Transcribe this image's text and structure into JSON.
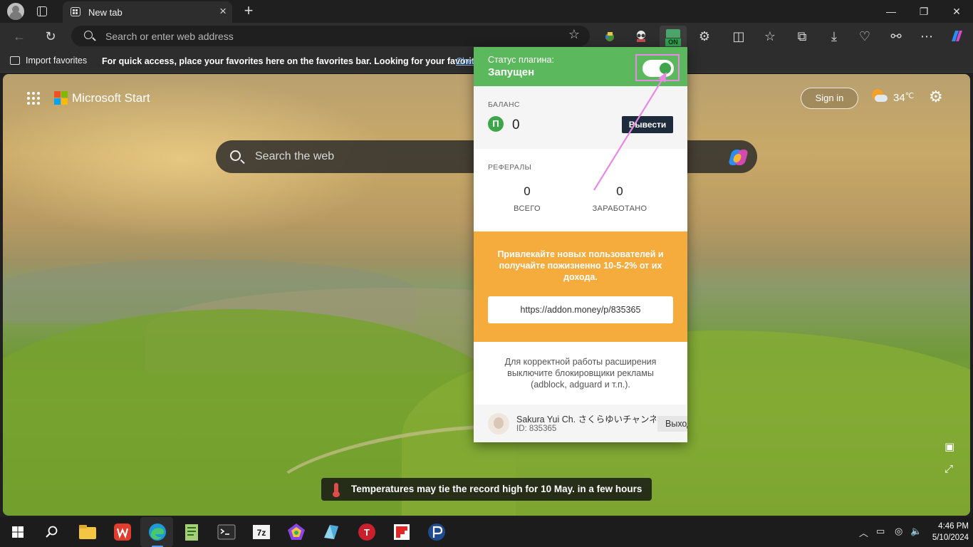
{
  "browser": {
    "tab_title": "New tab",
    "tab_close": "×",
    "new_tab": "+",
    "window_controls": {
      "minimize": "—",
      "maximize": "❐",
      "close": "✕"
    },
    "address_placeholder": "Search or enter web address",
    "favorites_bar": {
      "import_label": "Import favorites",
      "message": "For quick access, place your favorites here on the favorites bar. Looking for your favorites?",
      "link_text": "Chec"
    },
    "toolbar_icons": [
      "back-icon",
      "refresh-icon",
      "extension-icon-1",
      "extension-icon-2",
      "extension-on-icon",
      "extensions-icon",
      "split-screen-icon",
      "favorites-icon",
      "collections-icon",
      "downloads-icon",
      "browser-essentials-icon",
      "profile-sync-icon",
      "more-icon",
      "copilot-icon"
    ],
    "extension_badge": "ON"
  },
  "start_page": {
    "brand": "Microsoft Start",
    "sign_in": "Sign in",
    "temperature": "34",
    "temperature_unit": "℃",
    "search_placeholder": "Search the web",
    "news_ticker": "Temperatures may tie the record high for 10 May. in a few hours",
    "brand_colors": [
      "#f25022",
      "#7fba00",
      "#00a4ef",
      "#ffb900"
    ]
  },
  "popup": {
    "status_label": "Статус плагина:",
    "status_value": "Запущен",
    "toggle_on": true,
    "balance": {
      "title": "БАЛАНС",
      "currency_symbol": "П",
      "value": "0",
      "withdraw_button": "Вывести"
    },
    "referrals": {
      "title": "РЕФЕРАЛЫ",
      "total_value": "0",
      "total_label": "ВСЕГО",
      "earned_value": "0",
      "earned_label": "ЗАРАБОТАНО"
    },
    "promo": {
      "text": "Привлекайте новых пользователей и получайте пожизненно 10-5-2% от их дохода.",
      "link": "https://addon.money/p/835365"
    },
    "note": "Для корректной работы расширения выключите блокировщики рекламы (adblock, adguard и т.п.).",
    "user": {
      "name": "Sakura Yui Ch. さくらゆいチャンネル",
      "id": "ID: 835365",
      "logout": "Выход"
    },
    "colors": {
      "header": "#5cb85c",
      "promo": "#f6ab3d",
      "withdraw": "#1e2b3c",
      "highlight": "#e889e3"
    }
  },
  "taskbar": {
    "apps": [
      "file-explorer",
      "wps-office",
      "microsoft-edge",
      "notepad-plus-plus",
      "terminal",
      "7zip",
      "app-pentagon",
      "app-prism",
      "app-t",
      "app-flipboard",
      "app-p"
    ],
    "clock_time": "4:46 PM",
    "clock_date": "5/10/2024"
  }
}
